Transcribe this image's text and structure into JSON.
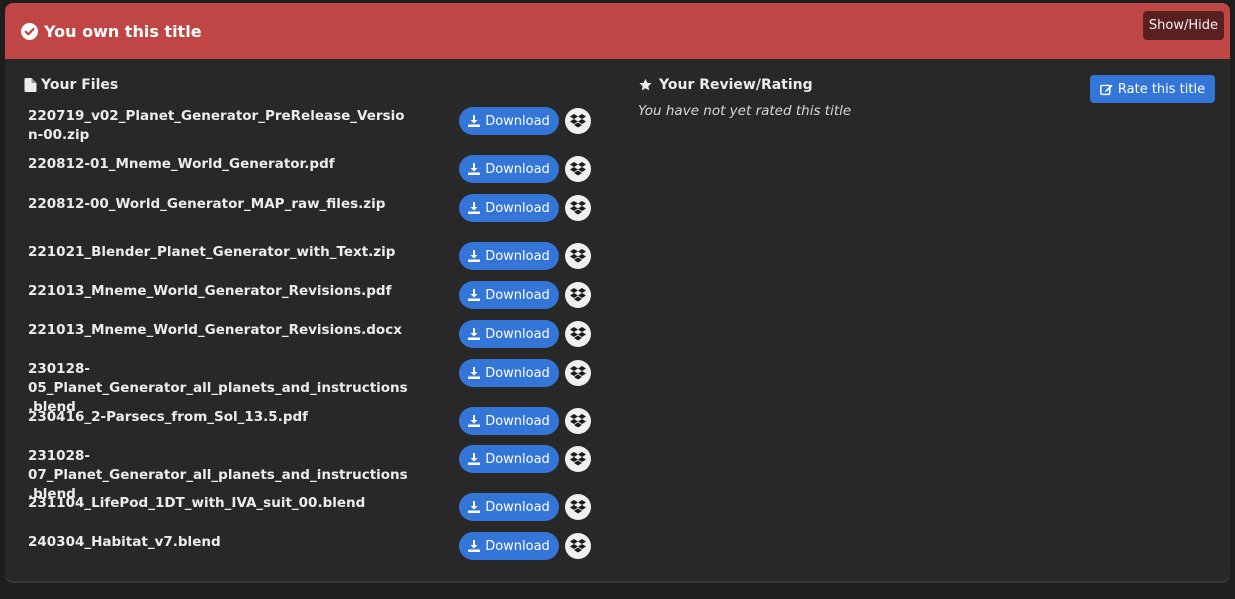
{
  "header": {
    "title": "You own this title",
    "toggle_label": "Show/Hide",
    "background_color": "#c04545"
  },
  "files_section": {
    "title": "Your Files",
    "download_label": "Download",
    "items": [
      {
        "name": "220719_v02_Planet_Generator_PreRelease_Version-00.zip"
      },
      {
        "name": "220812-01_Mneme_World_Generator.pdf"
      },
      {
        "name": "220812-00_World_Generator_MAP_raw_files.zip"
      },
      {
        "name": "221021_Blender_Planet_Generator_with_Text.zip"
      },
      {
        "name": "221013_Mneme_World_Generator_Revisions.pdf"
      },
      {
        "name": "221013_Mneme_World_Generator_Revisions.docx"
      },
      {
        "name": "230128-05_Planet_Generator_all_planets_and_instructions.blend"
      },
      {
        "name": "230416_2-Parsecs_from_Sol_13.5.pdf"
      },
      {
        "name": "231028-07_Planet_Generator_all_planets_and_instructions.blend"
      },
      {
        "name": "231104_LifePod_1DT_with_IVA_suit_00.blend"
      },
      {
        "name": "240304_Habitat_v7.blend"
      }
    ]
  },
  "review_section": {
    "title": "Your Review/Rating",
    "empty_text": "You have not yet rated this title",
    "rate_button_label": "Rate this title"
  },
  "colors": {
    "accent": "#3475d8",
    "panel": "#282828",
    "page": "#1e1e1e"
  }
}
